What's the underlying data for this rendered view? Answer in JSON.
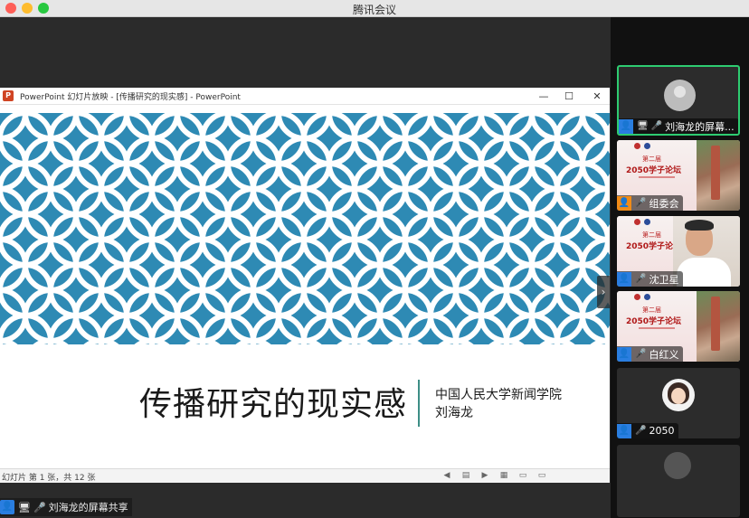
{
  "window": {
    "title": "腾讯会议"
  },
  "powerpoint": {
    "logo": "P",
    "title": "PowerPoint 幻灯片放映 - [传播研究的现实感] - PowerPoint",
    "controls": {
      "minimize": "—",
      "maximize": "☐",
      "close": "✕"
    },
    "status": "幻灯片 第 1 张，共 12 张",
    "status_icons": [
      "◀",
      "▤",
      "▶",
      "▦",
      "▭",
      "▭"
    ]
  },
  "slide": {
    "title": "传播研究的现实感",
    "organization": "中国人民大学新闻学院",
    "author": "刘海龙",
    "next_arrow": "›",
    "pattern_color": "#2e8ab4",
    "divider_color": "#3d8e86"
  },
  "share_bar": {
    "user_icon": "👤",
    "screen_icon": "🖥",
    "mic_icon": "🎤",
    "label": "刘海龙的屏幕共享"
  },
  "participants": [
    {
      "name": "刘海龙的屏幕...",
      "type": "avatar",
      "active": true,
      "icons": [
        "👤",
        "🖥",
        "🎤"
      ]
    },
    {
      "name": "组委会",
      "type": "poster",
      "icons": [
        "👤",
        "🎤"
      ],
      "poster_sub": "第二届",
      "poster_main": "2050学子论坛"
    },
    {
      "name": "沈卫星",
      "type": "poster-person",
      "icons": [
        "👤",
        "🎤"
      ],
      "poster_sub": "第二届",
      "poster_main": "2050学子论坛"
    },
    {
      "name": "白红义",
      "type": "poster",
      "icons": [
        "👤",
        "🎤"
      ],
      "poster_sub": "第二届",
      "poster_main": "2050学子论坛"
    },
    {
      "name": "2050",
      "type": "cartoon",
      "icons": [
        "👤",
        "🎤"
      ]
    },
    {
      "name": "",
      "type": "partial"
    }
  ],
  "colors": {
    "active_border": "#2ecc71",
    "user_badge": "#2a7ee0",
    "host_badge": "#f08b18",
    "mic_active": "#4cd964"
  }
}
